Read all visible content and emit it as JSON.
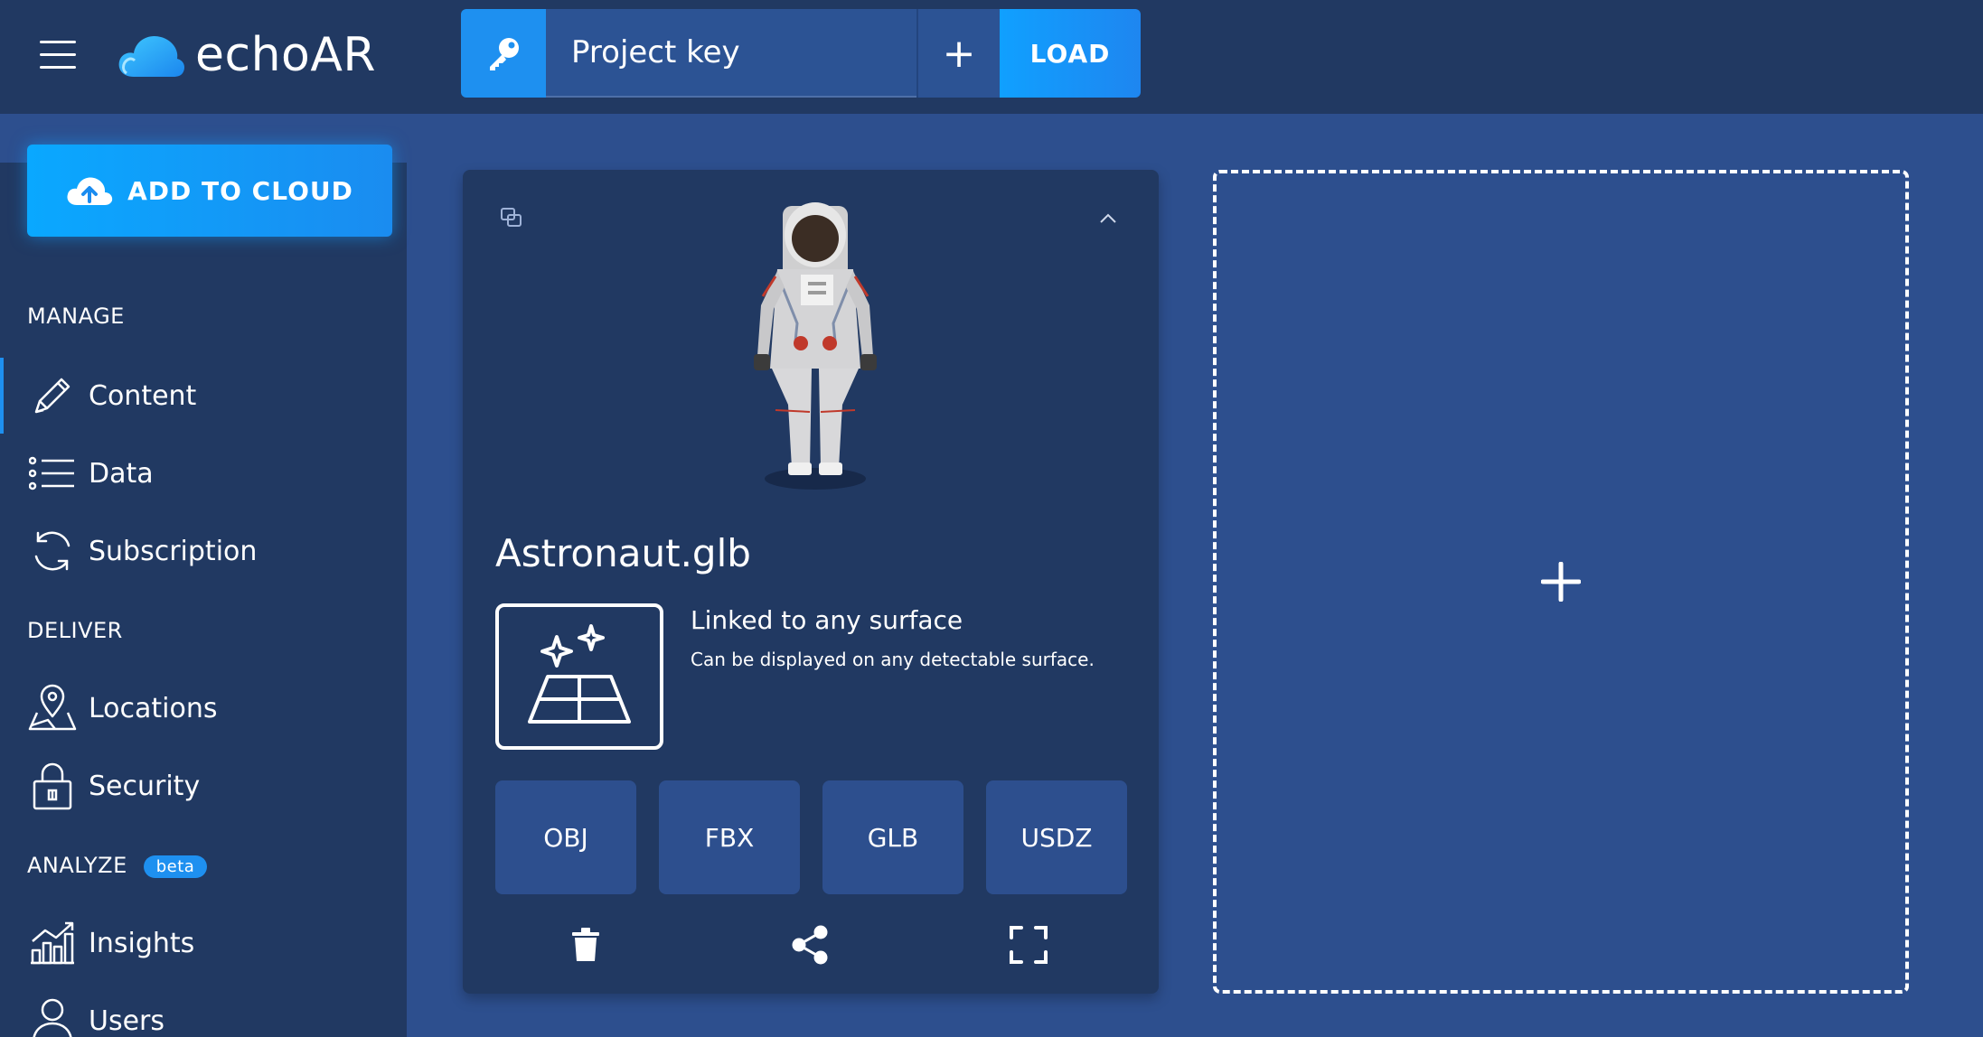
{
  "header": {
    "brand": "echoAR",
    "project_key_placeholder": "Project key",
    "add_key_label": "+",
    "load_label": "LOAD"
  },
  "sidebar": {
    "add_to_cloud_label": "ADD TO CLOUD",
    "sections": {
      "manage": "MANAGE",
      "deliver": "DELIVER",
      "analyze": "ANALYZE",
      "analyze_badge": "beta"
    },
    "items": [
      {
        "label": "Content",
        "icon": "pencil-icon"
      },
      {
        "label": "Data",
        "icon": "list-icon"
      },
      {
        "label": "Subscription",
        "icon": "refresh-icon"
      },
      {
        "label": "Locations",
        "icon": "map-pin-icon"
      },
      {
        "label": "Security",
        "icon": "lock-icon"
      },
      {
        "label": "Insights",
        "icon": "chart-icon"
      },
      {
        "label": "Users",
        "icon": "user-icon"
      }
    ]
  },
  "card": {
    "asset_name": "Astronaut.glb",
    "surface_title": "Linked to any surface",
    "surface_description": "Can be displayed on any detectable surface.",
    "formats": [
      "OBJ",
      "FBX",
      "GLB",
      "USDZ"
    ]
  },
  "dropzone": {
    "plus_label": "+"
  },
  "colors": {
    "topbar": "#213962",
    "background": "#2d4f8e",
    "accent": "#1e90f0"
  }
}
